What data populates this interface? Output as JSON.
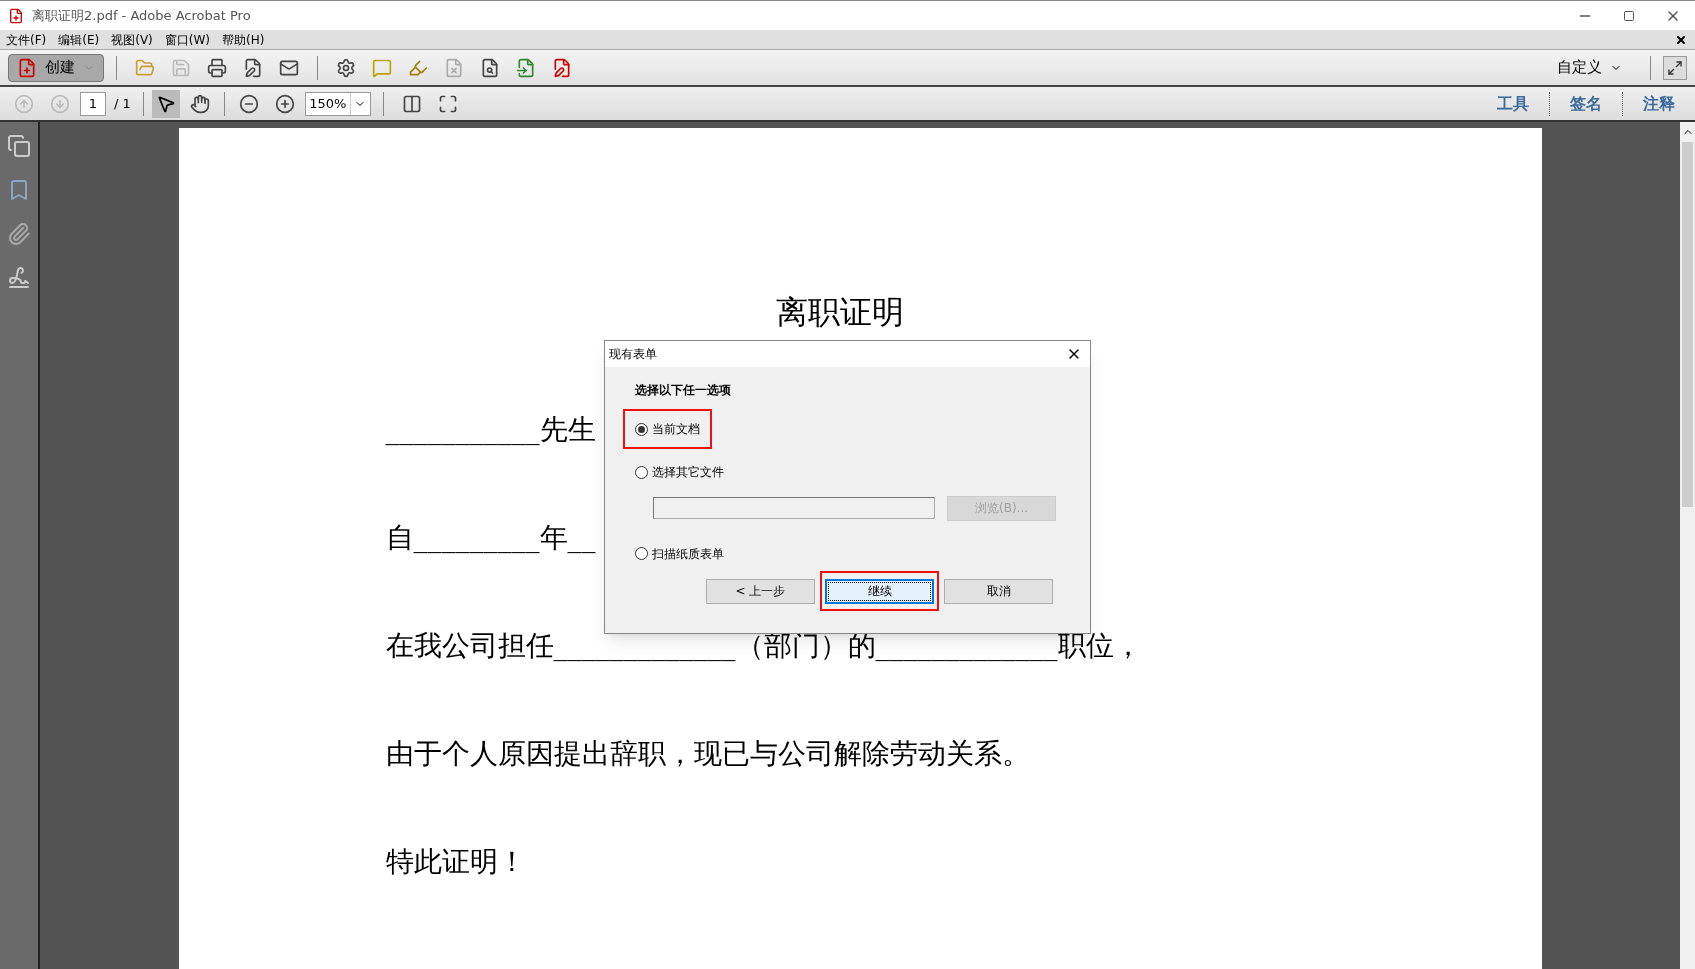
{
  "window": {
    "title": "离职证明2.pdf - Adobe Acrobat Pro"
  },
  "menu": [
    "文件(F)",
    "编辑(E)",
    "视图(V)",
    "窗口(W)",
    "帮助(H)"
  ],
  "toolbar": {
    "create": "创建",
    "customize": "自定义"
  },
  "nav": {
    "page": "1",
    "page_count": "/ 1",
    "zoom": "150%"
  },
  "panes": [
    {
      "label": "工具"
    },
    {
      "label": "签名"
    },
    {
      "label": "注释"
    }
  ],
  "document": {
    "title": "离职证明",
    "lines": [
      "___________先生",
      "自_________年__",
      "在我公司担任_____________（部门）的_____________职位，",
      "由于个人原因提出辞职，现已与公司解除劳动关系。",
      "特此证明！"
    ]
  },
  "dialog": {
    "title": "现有表单",
    "heading": "选择以下任一选项",
    "options": [
      {
        "label": "当前文档",
        "selected": true,
        "highlighted": true
      },
      {
        "label": "选择其它文件",
        "selected": false,
        "highlighted": false
      },
      {
        "label": "扫描纸质表单",
        "selected": false,
        "highlighted": false
      }
    ],
    "browse": {
      "label": "浏览(B)...",
      "disabled": true
    },
    "buttons": [
      {
        "label": "< 上一步",
        "focused": false,
        "highlighted": false
      },
      {
        "label": "继续",
        "focused": true,
        "highlighted": true
      },
      {
        "label": "取消",
        "focused": false,
        "highlighted": false
      }
    ]
  }
}
